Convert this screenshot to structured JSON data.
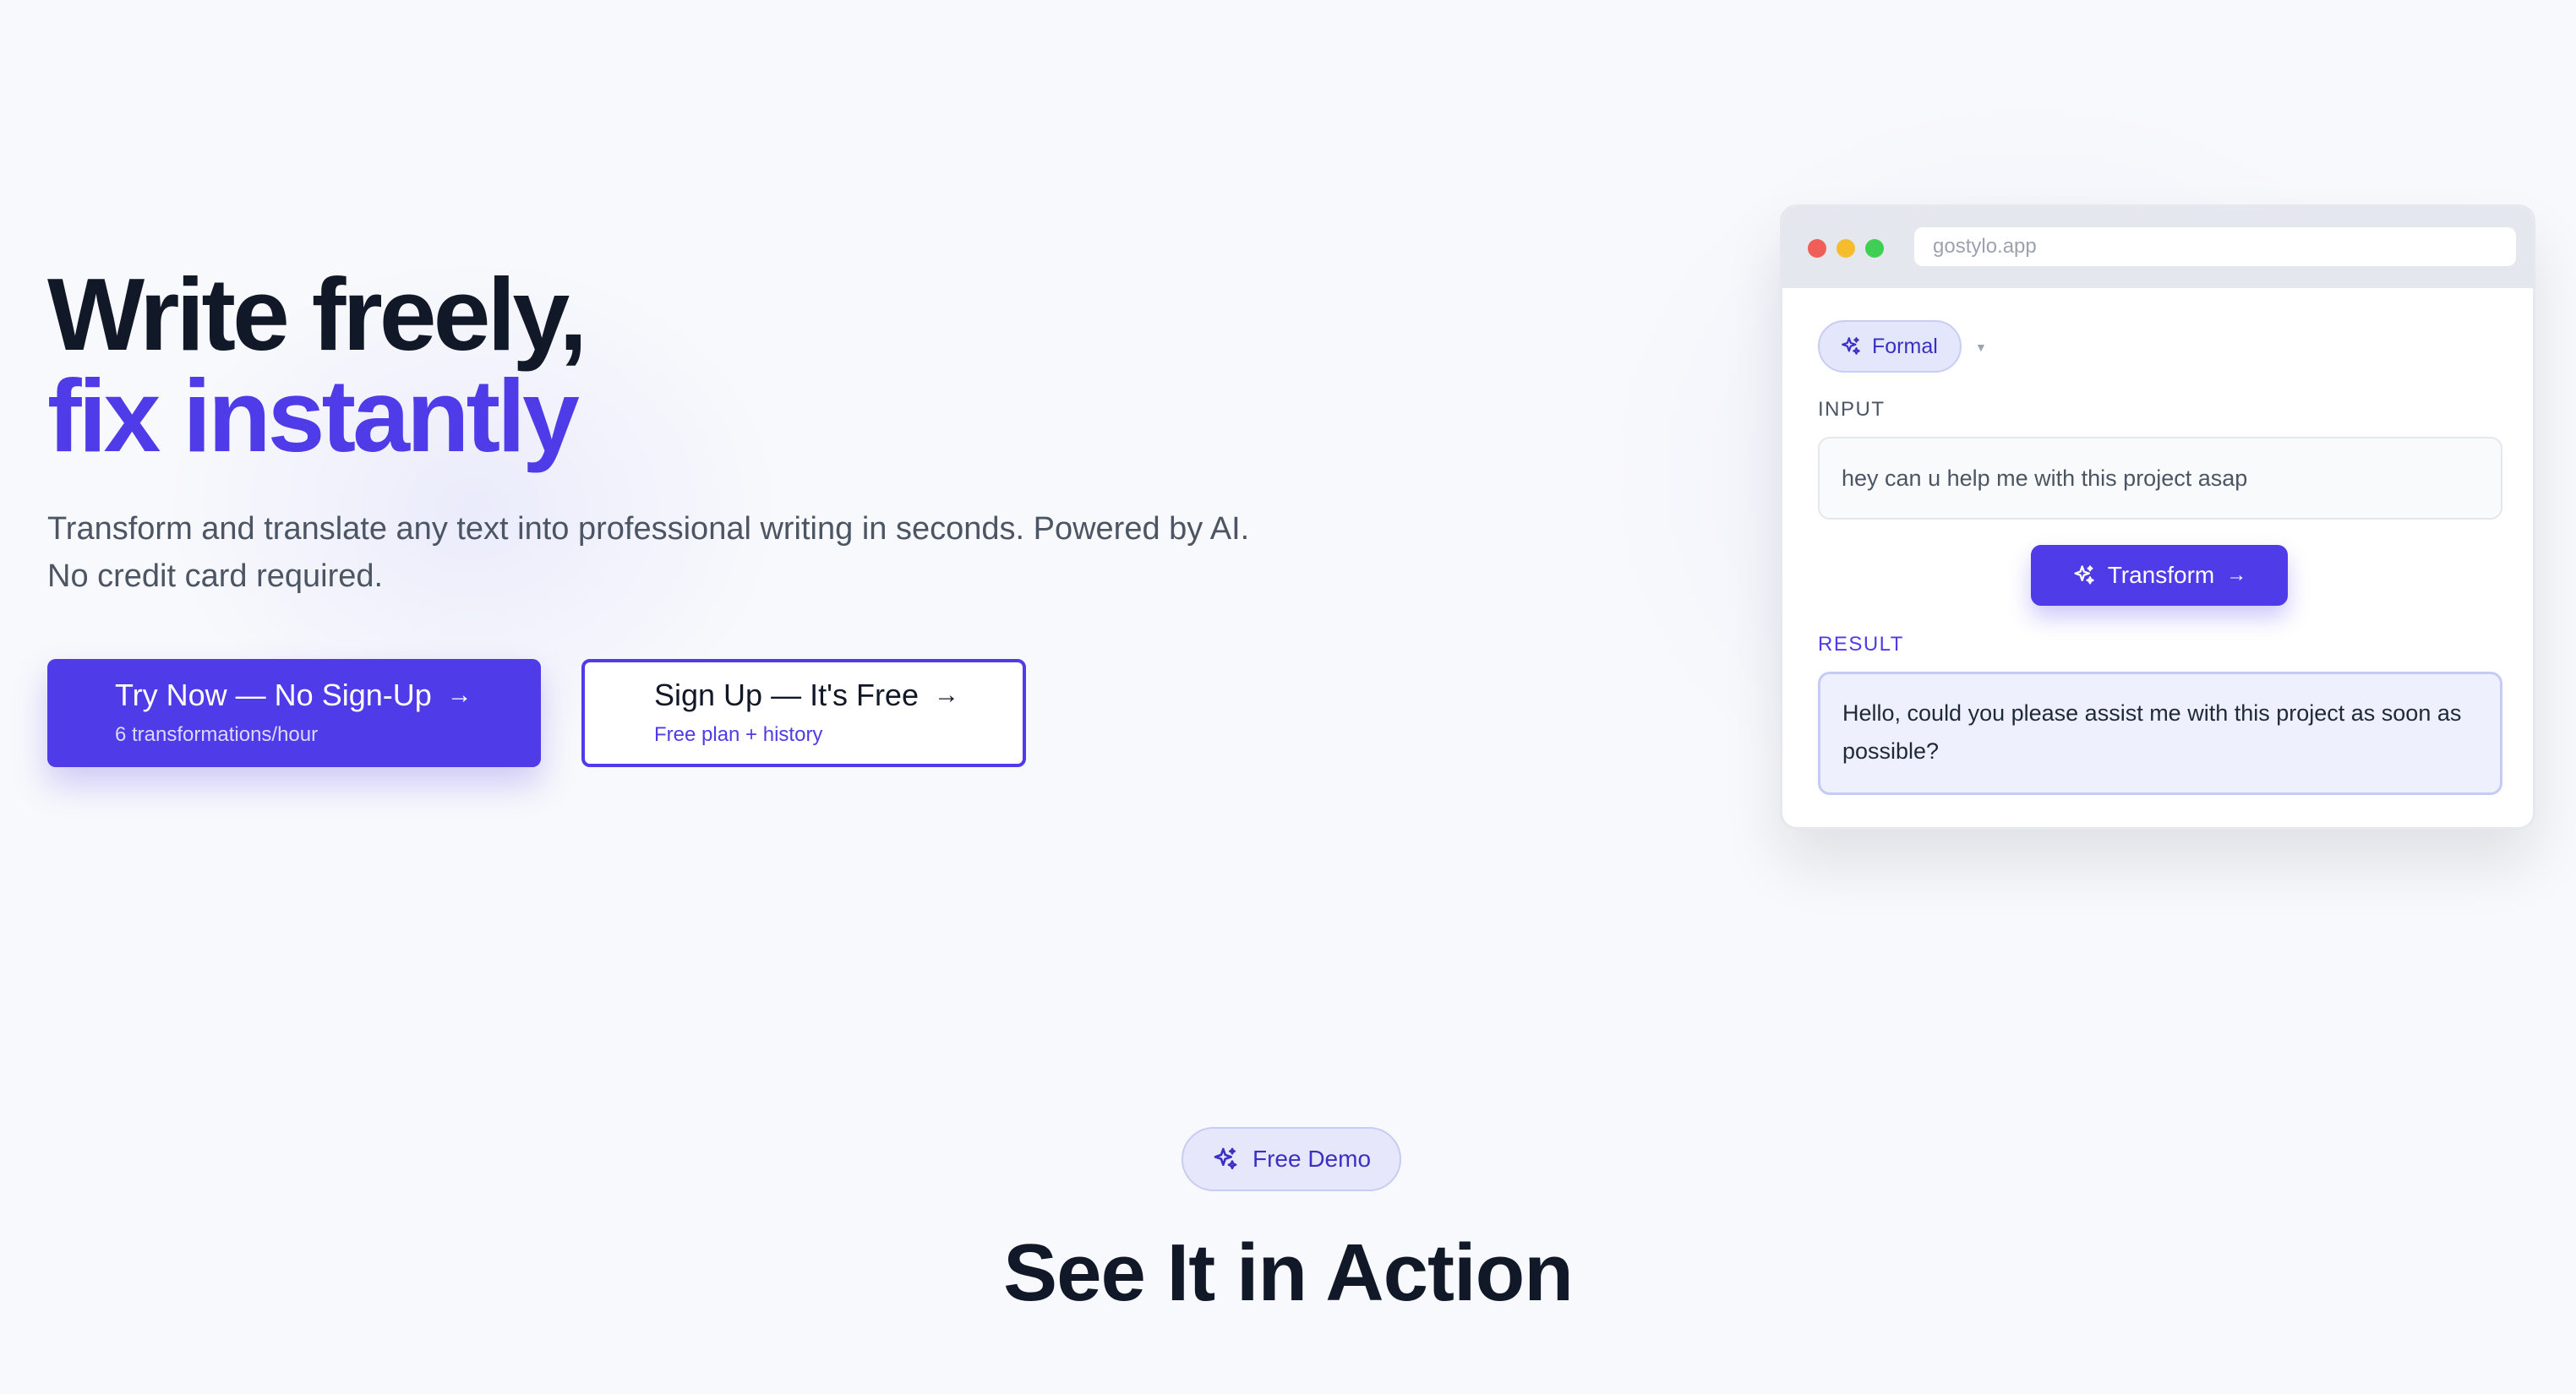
{
  "hero": {
    "title_line1": "Write freely,",
    "title_line2": "fix instantly",
    "subtitle": "Transform and translate any text into professional writing in seconds. Powered by AI. No credit card required."
  },
  "cta_primary": {
    "label": "Try Now — No Sign-Up",
    "note": "6 transformations/hour",
    "icon": "arrow-right-icon"
  },
  "cta_secondary": {
    "label": "Sign Up — It's Free",
    "note": "Free plan + history",
    "icon": "arrow-right-icon"
  },
  "mockup": {
    "url": "gostylo.app",
    "tone": "Formal",
    "input_label": "INPUT",
    "input_text": "hey can u help me with this project asap",
    "transform_label": "Transform",
    "result_label": "RESULT",
    "result_text": "Hello, could you please assist me with this project as soon as possible?"
  },
  "demo": {
    "badge": "Free Demo",
    "title": "See It in Action"
  },
  "colors": {
    "accent": "#4f3ce8",
    "heading": "#111827",
    "body_text": "#4b5563",
    "background": "#f8f9fc",
    "result_bg": "#eef0fd"
  },
  "icons": {
    "sparkle": "sparkles-icon",
    "arrow": "arrow-right-icon",
    "caret": "chevron-down-icon"
  }
}
